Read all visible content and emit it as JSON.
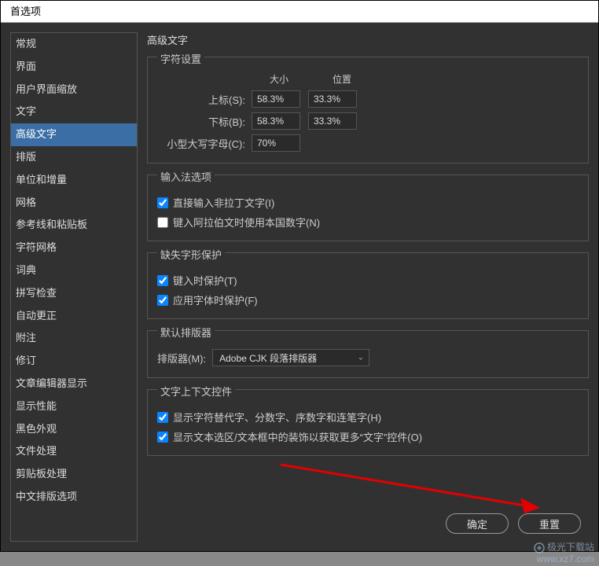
{
  "dialog": {
    "title": "首选项"
  },
  "sidebar": {
    "items": [
      {
        "label": "常规"
      },
      {
        "label": "界面"
      },
      {
        "label": "用户界面缩放"
      },
      {
        "label": "文字"
      },
      {
        "label": "高级文字",
        "selected": true
      },
      {
        "label": "排版"
      },
      {
        "label": "单位和增量"
      },
      {
        "label": "网格"
      },
      {
        "label": "参考线和粘贴板"
      },
      {
        "label": "字符网格"
      },
      {
        "label": "词典"
      },
      {
        "label": "拼写检查"
      },
      {
        "label": "自动更正"
      },
      {
        "label": "附注"
      },
      {
        "label": "修订"
      },
      {
        "label": "文章编辑器显示"
      },
      {
        "label": "显示性能"
      },
      {
        "label": "黑色外观"
      },
      {
        "label": "文件处理"
      },
      {
        "label": "剪贴板处理"
      },
      {
        "label": "中文排版选项"
      }
    ]
  },
  "page": {
    "title": "高级文字"
  },
  "charSettings": {
    "legend": "字符设置",
    "col1": "大小",
    "col2": "位置",
    "superscript": {
      "label": "上标(S):",
      "size": "58.3%",
      "position": "33.3%"
    },
    "subscript": {
      "label": "下标(B):",
      "size": "58.3%",
      "position": "33.3%"
    },
    "smallcaps": {
      "label": "小型大写字母(C):",
      "value": "70%"
    }
  },
  "ime": {
    "legend": "输入法选项",
    "opt1": {
      "label": "直接输入非拉丁文字(I)",
      "checked": true
    },
    "opt2": {
      "label": "键入阿拉伯文时使用本国数字(N)",
      "checked": false
    }
  },
  "glyphProtect": {
    "legend": "缺失字形保护",
    "opt1": {
      "label": "键入时保护(T)",
      "checked": true
    },
    "opt2": {
      "label": "应用字体时保护(F)",
      "checked": true
    }
  },
  "defaultComposer": {
    "legend": "默认排版器",
    "label": "排版器(M):",
    "value": "Adobe CJK 段落排版器"
  },
  "contextControls": {
    "legend": "文字上下文控件",
    "opt1": {
      "label": "显示字符替代字、分数字、序数字和连笔字(H)",
      "checked": true
    },
    "opt2": {
      "label": "显示文本选区/文本框中的装饰以获取更多“文字”控件(O)",
      "checked": true
    }
  },
  "actions": {
    "ok": "确定",
    "reset": "重置"
  },
  "watermark": {
    "line1": "极光下载站",
    "line2": "www.xz7.com"
  }
}
